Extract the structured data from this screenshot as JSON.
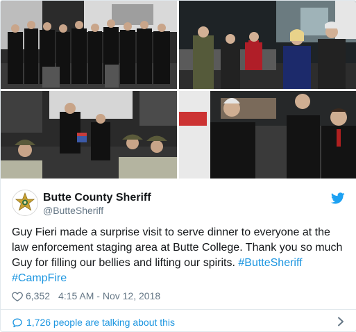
{
  "author": {
    "name": "Butte County Sheriff",
    "handle": "@ButteSheriff"
  },
  "tweet": {
    "text_plain": "Guy Fieri made a surprise visit to serve dinner to everyone at the law enforcement staging area at Butte College. Thank you so much Guy for filling our bellies and lifting our spirits. ",
    "hashtag_1": "#ButteSheriff",
    "hashtag_2": "#CampFire"
  },
  "meta": {
    "likes": "6,352",
    "timestamp": "4:15 AM - Nov 12, 2018"
  },
  "footer": {
    "conversation": "1,726 people are talking about this"
  },
  "icons": {
    "brand": "twitter-bird-icon",
    "like": "heart-icon",
    "reply": "speech-bubble-icon",
    "expand": "chevron-right-icon",
    "avatar": "sheriff-star-badge"
  },
  "colors": {
    "twitter_blue": "#1da1f2",
    "link_blue": "#1b95e0",
    "text": "#14171a",
    "muted": "#657786",
    "border": "#e1e8ed"
  }
}
